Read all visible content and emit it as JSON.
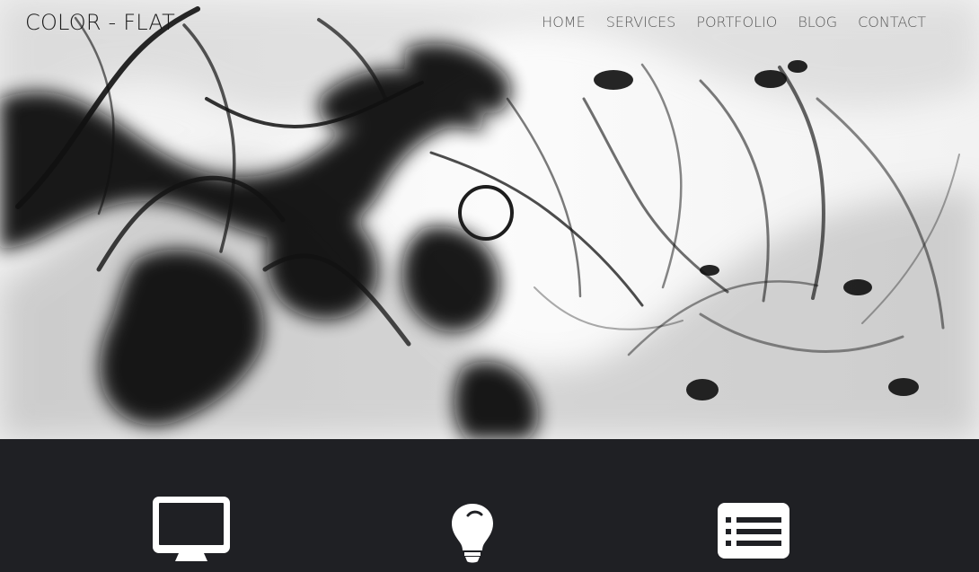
{
  "header": {
    "brand": "COLOR - FLAT",
    "nav": [
      {
        "label": "HOME"
      },
      {
        "label": "SERVICES"
      },
      {
        "label": "PORTFOLIO"
      },
      {
        "label": "BLOG"
      },
      {
        "label": "CONTACT"
      }
    ]
  },
  "hero": {
    "background_image": "black-ink-in-water",
    "loader_icon": "circle-icon"
  },
  "services": [
    {
      "icon": "desktop-icon"
    },
    {
      "icon": "lightbulb-icon"
    },
    {
      "icon": "list-icon"
    }
  ],
  "colors": {
    "dark_band": "#1f2024",
    "icon_white": "#ffffff",
    "text_dark": "#1b1b1b",
    "text_gray": "#5a5a5a"
  }
}
